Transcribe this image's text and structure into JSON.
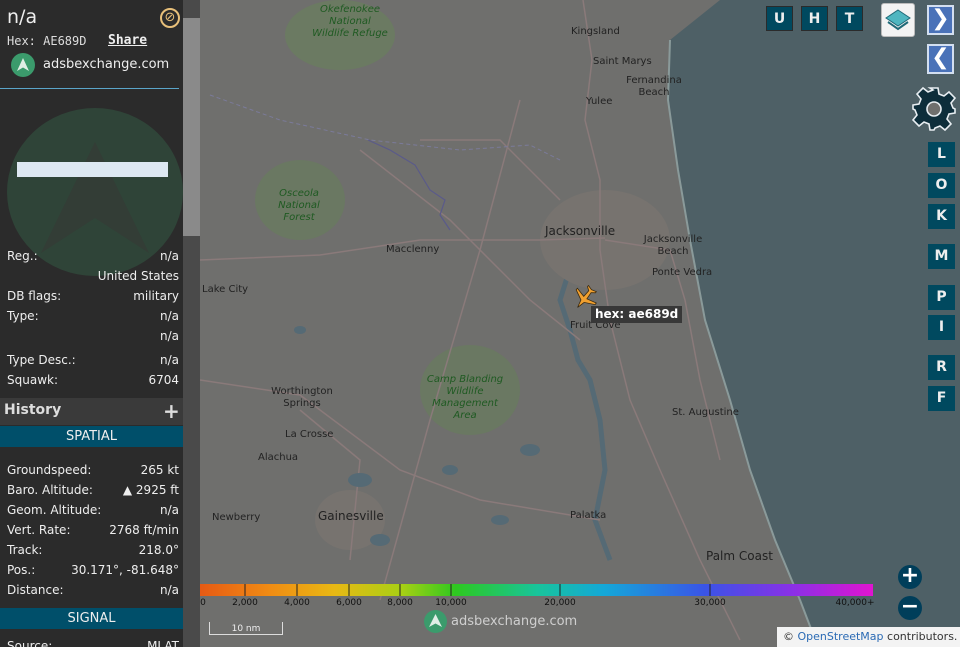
{
  "aircraft": {
    "callsign": "n/a",
    "hex_line": "Hex: AE689D",
    "share_label": "Share",
    "close_icon": "⊘",
    "logo_text": "adsbexchange.com"
  },
  "details": [
    {
      "key": "Reg.:",
      "value": "n/a"
    },
    {
      "key": "",
      "value": "United States"
    },
    {
      "key": "DB flags:",
      "value": "military"
    },
    {
      "key": "Type:",
      "value": "n/a"
    },
    {
      "key": "",
      "value": "n/a"
    },
    {
      "key": "Type Desc.:",
      "value": "n/a"
    },
    {
      "key": "Squawk:",
      "value": "6704"
    }
  ],
  "history": {
    "label": "History",
    "add_icon": "+"
  },
  "spatial": {
    "header": "SPATIAL",
    "rows": [
      {
        "key": "Groundspeed:",
        "value": "265 kt"
      },
      {
        "key": "Baro. Altitude:",
        "value": "▲ 2925 ft"
      },
      {
        "key": "Geom. Altitude:",
        "value": "n/a"
      },
      {
        "key": "Vert. Rate:",
        "value": "2768 ft/min"
      },
      {
        "key": "Track:",
        "value": "218.0°"
      },
      {
        "key": "Pos.:",
        "value": "30.171°, -81.648°"
      },
      {
        "key": "Distance:",
        "value": "n/a"
      }
    ]
  },
  "signal": {
    "header": "SIGNAL",
    "source_key": "Source:",
    "source_value": "MLAT"
  },
  "toolbar": {
    "top_buttons": [
      "U",
      "H",
      "T"
    ],
    "side_buttons": [
      "L",
      "O",
      "K",
      "M",
      "P",
      "I",
      "R",
      "F"
    ],
    "chevron_right": "❯",
    "chevron_left": "❮",
    "zoom_in": "+",
    "zoom_out": "−"
  },
  "map": {
    "places": [
      {
        "name": "Kingsland"
      },
      {
        "name": "Saint Marys"
      },
      {
        "name": "Fernandina Beach"
      },
      {
        "name": "Yulee"
      },
      {
        "name": "Jacksonville"
      },
      {
        "name": "Jacksonville Beach"
      },
      {
        "name": "Ponte Vedra"
      },
      {
        "name": "Macclenny"
      },
      {
        "name": "Lake City"
      },
      {
        "name": "Fruit Cove"
      },
      {
        "name": "Worthington Springs"
      },
      {
        "name": "La Crosse"
      },
      {
        "name": "Alachua"
      },
      {
        "name": "Gainesville"
      },
      {
        "name": "Newberry"
      },
      {
        "name": "St. Augustine"
      },
      {
        "name": "Palatka"
      },
      {
        "name": "Palm Coast"
      }
    ],
    "parks": [
      {
        "name": "Okefenokee National Wildlife Refuge"
      },
      {
        "name": "Osceola National Forest"
      },
      {
        "name": "Camp Blanding Wildlife Management Area"
      }
    ],
    "plane_label": "hex: ae689d",
    "altitude_ticks": [
      "0",
      "2,000",
      "4,000",
      "6,000",
      "8,000",
      "10,000",
      "20,000",
      "30,000",
      "40,000+"
    ],
    "scale_label": "10 nm",
    "watermark": "adsbexchange.com",
    "attribution_prefix": "© ",
    "attribution_link": "OpenStreetMap",
    "attribution_suffix": " contributors."
  },
  "colors": {
    "sidebar_bg": "#2b2b2b",
    "section_header": "#004f6a",
    "button": "#00495f",
    "aircraft_icon": "#f0a030",
    "ocean": "#4e6066",
    "land": "#6f6f6d"
  }
}
